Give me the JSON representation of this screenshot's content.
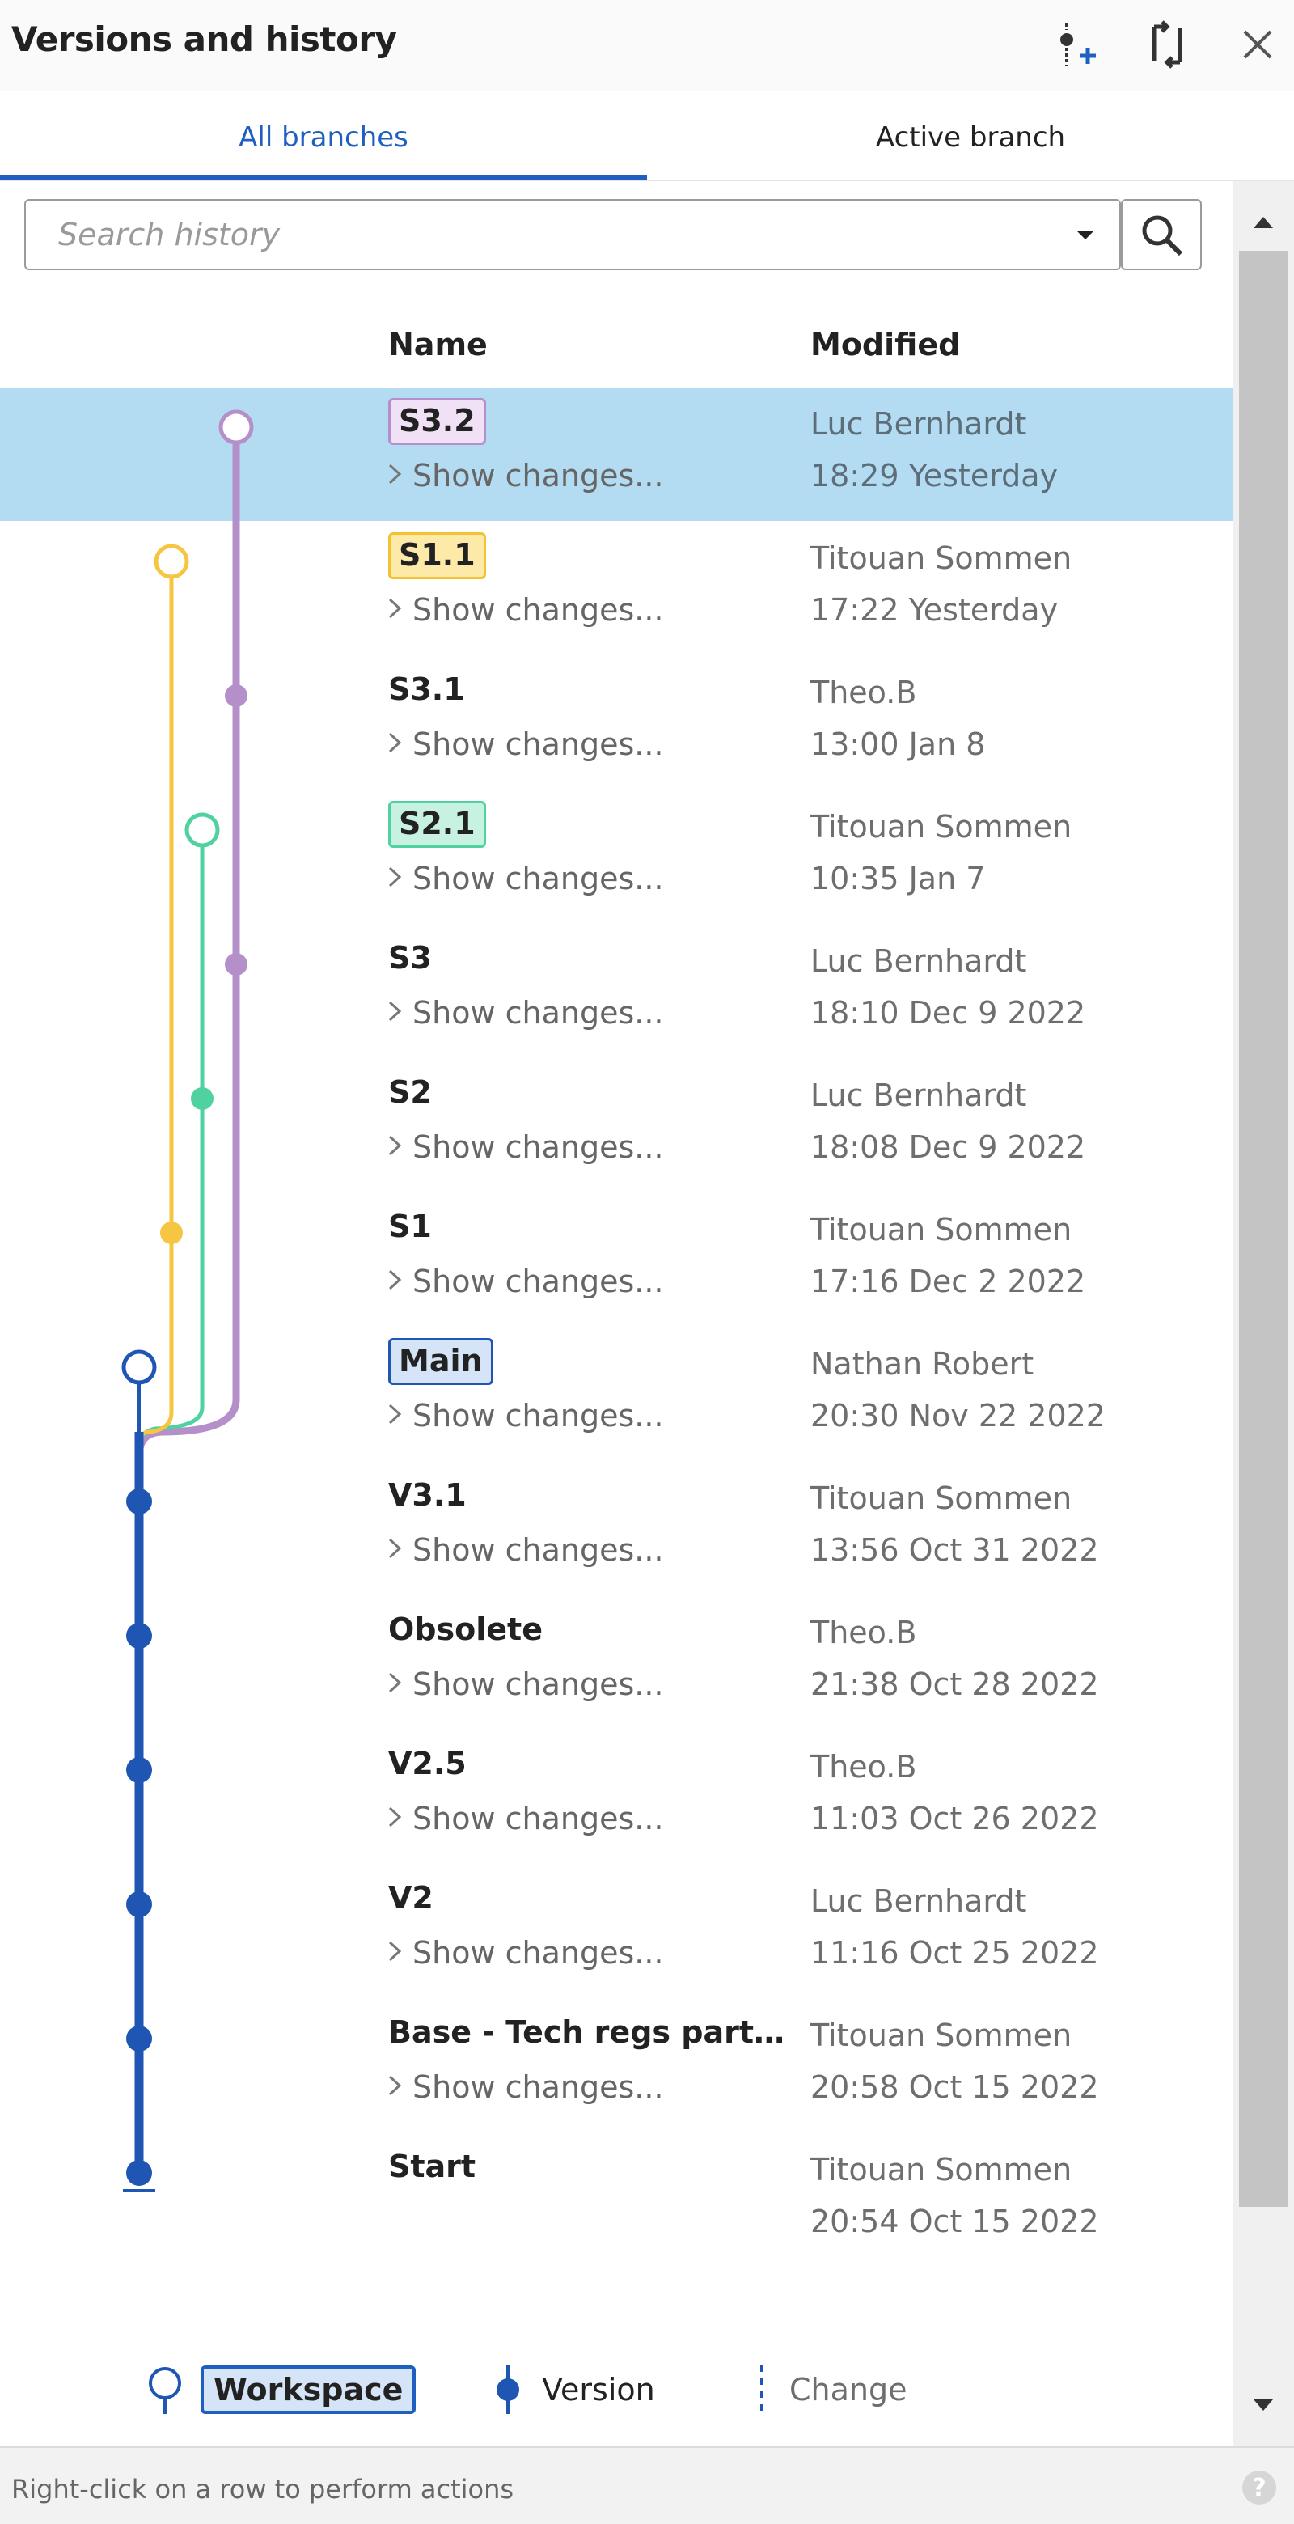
{
  "panel": {
    "title": "Versions and history",
    "icons": [
      "create-version-icon",
      "compare-icon",
      "close-icon"
    ]
  },
  "tabs": [
    {
      "label": "All branches",
      "active": true
    },
    {
      "label": "Active branch",
      "active": false
    }
  ],
  "search": {
    "placeholder": "Search history",
    "value": ""
  },
  "columns": {
    "name": "Name",
    "modified": "Modified"
  },
  "rows": [
    {
      "name": "S3.2",
      "tag": "purple",
      "show": "Show changes...",
      "author": "Luc Bernhardt",
      "time": "18:29 Yesterday",
      "selected": true
    },
    {
      "name": "S1.1",
      "tag": "yellow",
      "show": "Show changes...",
      "author": "Titouan Sommen",
      "time": "17:22 Yesterday"
    },
    {
      "name": "S3.1",
      "tag": null,
      "show": "Show changes...",
      "author": "Theo.B",
      "time": "13:00 Jan 8"
    },
    {
      "name": "S2.1",
      "tag": "green",
      "show": "Show changes...",
      "author": "Titouan Sommen",
      "time": "10:35 Jan 7"
    },
    {
      "name": "S3",
      "tag": null,
      "show": "Show changes...",
      "author": "Luc Bernhardt",
      "time": "18:10 Dec 9 2022"
    },
    {
      "name": "S2",
      "tag": null,
      "show": "Show changes...",
      "author": "Luc Bernhardt",
      "time": "18:08 Dec 9 2022"
    },
    {
      "name": "S1",
      "tag": null,
      "show": "Show changes...",
      "author": "Titouan Sommen",
      "time": "17:16 Dec 2 2022"
    },
    {
      "name": "Main",
      "tag": "blue",
      "show": "Show changes...",
      "author": "Nathan Robert",
      "time": "20:30 Nov 22 2022"
    },
    {
      "name": "V3.1",
      "tag": null,
      "show": "Show changes...",
      "author": "Titouan Sommen",
      "time": "13:56 Oct 31 2022"
    },
    {
      "name": "Obsolete",
      "tag": null,
      "show": "Show changes...",
      "author": "Theo.B",
      "time": "21:38 Oct 28 2022"
    },
    {
      "name": "V2.5",
      "tag": null,
      "show": "Show changes...",
      "author": "Theo.B",
      "time": "11:03 Oct 26 2022"
    },
    {
      "name": "V2",
      "tag": null,
      "show": "Show changes...",
      "author": "Luc Bernhardt",
      "time": "11:16 Oct 25 2022"
    },
    {
      "name": "Base - Tech regs parti...",
      "tag": null,
      "show": "Show changes...",
      "author": "Titouan Sommen",
      "time": "20:58 Oct 15 2022"
    },
    {
      "name": "Start",
      "tag": null,
      "show": null,
      "author": "Titouan Sommen",
      "time": "20:54 Oct 15 2022"
    }
  ],
  "legend": {
    "workspace": "Workspace",
    "version": "Version",
    "change": "Change"
  },
  "footer": {
    "text": "Right-click on a row to perform actions",
    "help": "?"
  },
  "colors": {
    "purple": "#b58fc9",
    "yellow": "#f6c542",
    "green": "#4fd1a0",
    "blue": "#1f55b3",
    "selected_row": "#b3dcf3",
    "accent": "#1f5fbf"
  }
}
